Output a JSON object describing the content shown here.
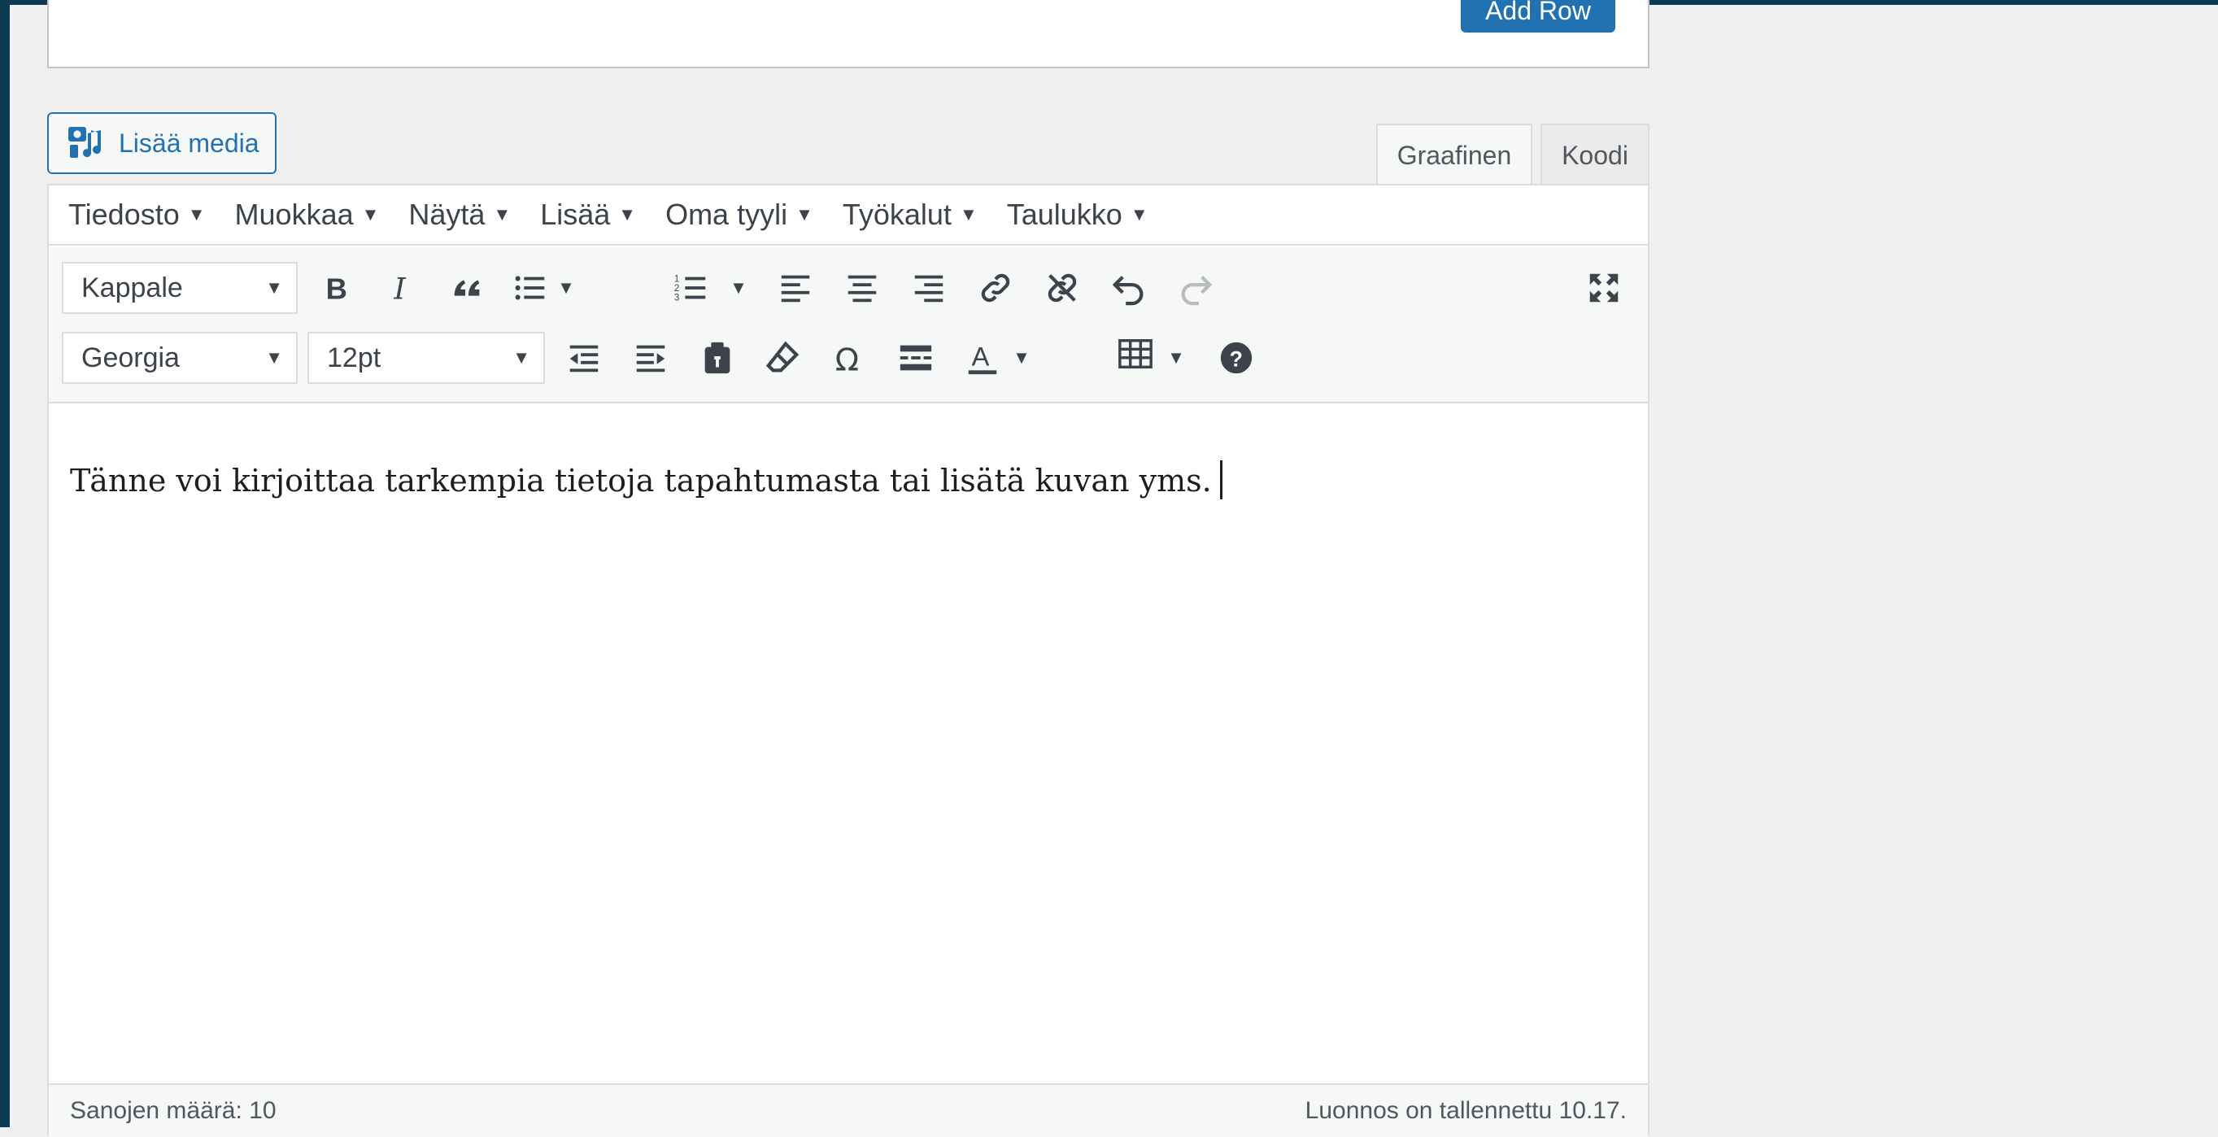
{
  "top_panel": {
    "add_row_label": "Add Row"
  },
  "media_button": {
    "label": "Lisää media"
  },
  "tabs": {
    "visual": "Graafinen",
    "text": "Koodi"
  },
  "menubar": {
    "items": [
      {
        "label": "Tiedosto"
      },
      {
        "label": "Muokkaa"
      },
      {
        "label": "Näytä"
      },
      {
        "label": "Lisää"
      },
      {
        "label": "Oma tyyli"
      },
      {
        "label": "Työkalut"
      },
      {
        "label": "Taulukko"
      }
    ]
  },
  "toolbar": {
    "format_select": "Kappale",
    "font_select": "Georgia",
    "size_select": "12pt"
  },
  "content": {
    "text": "Tänne voi kirjoittaa tarkempia tietoja tapahtumasta tai lisätä kuvan yms."
  },
  "status": {
    "word_count": "Sanojen määrä: 10",
    "draft_saved": "Luonnos on tallennettu 10.17."
  },
  "colors": {
    "accent": "#2271b1",
    "frame": "#0b3a53"
  }
}
